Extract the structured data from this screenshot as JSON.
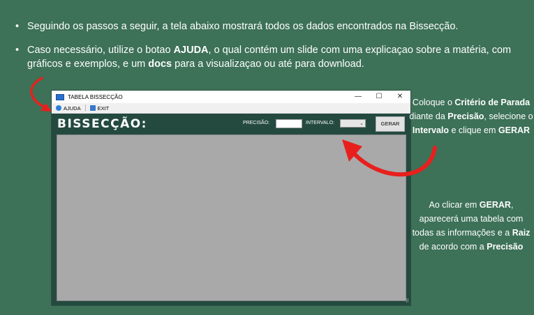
{
  "instructions": {
    "bullet1": "Seguindo os passos a seguir, a tela abaixo mostrará todos os dados encontrados na Bissecção.",
    "bullet2_pre": "Caso necessário, utilize o botao ",
    "bullet2_ajuda": "AJUDA",
    "bullet2_mid": ", o qual contém um slide com uma explicaçao sobre a matéria, com gráficos e exemplos, e um ",
    "bullet2_docs": "docs",
    "bullet2_post": " para a visualizaçao ou até para download."
  },
  "window": {
    "title": "TABELA BISSECÇÃO",
    "minimize": "—",
    "maximize": "☐",
    "close": "✕",
    "menu": {
      "ajuda": "AJUDA",
      "exit": "EXIT"
    },
    "app_title": "BISSECÇÃO:",
    "precisao_label": "PRECISÃO:",
    "precisao_value": "",
    "intervalo_label": "INTERVALO:",
    "intervalo_value": "",
    "dropdown_arrow": "⌄",
    "gerar_label": "GERAR",
    "grip": "⠿"
  },
  "callouts": {
    "c1_a": "Coloque o ",
    "c1_b": "Critério de Parada",
    "c1_c": " diante da ",
    "c1_d": "Precisão",
    "c1_e": ", selecione o ",
    "c1_f": "Intervalo",
    "c1_g": " e clique em ",
    "c1_h": "GERAR",
    "c2_a": "Ao clicar em ",
    "c2_b": "GERAR",
    "c2_c": ", aparecerá uma tabela com todas as informações e a ",
    "c2_d": "Raiz",
    "c2_e": " de acordo com a ",
    "c2_f": "Precisão"
  },
  "colors": {
    "background": "#3d7158",
    "panel": "#244a40",
    "arrow": "#e8201d"
  }
}
